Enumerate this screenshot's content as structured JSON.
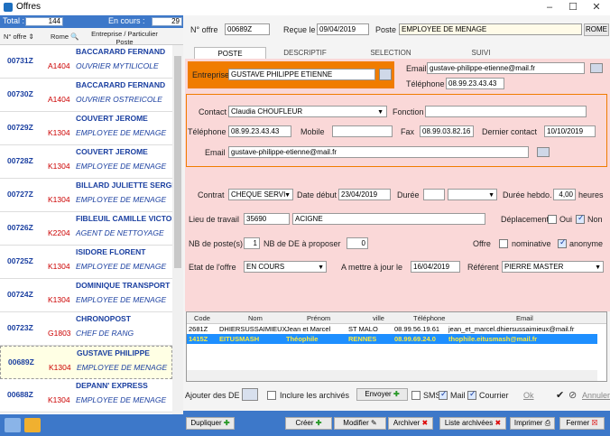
{
  "window": {
    "title": "Offres",
    "min": "–",
    "max": "☐",
    "close": "✕"
  },
  "left": {
    "total_label": "Total :",
    "total_value": "144",
    "en_cours_label": "En cours :",
    "en_cours_value": "29",
    "col_offre": "N° offre",
    "col_rome": "Rome",
    "col_entreprise": "Entreprise / Particulier",
    "col_poste": "Poste",
    "rows": [
      {
        "num": "00731Z",
        "rome": "A1404",
        "company": "BACCARARD FERNAND",
        "job": "OUVRIER MYTILICOLE"
      },
      {
        "num": "00730Z",
        "rome": "A1404",
        "company": "BACCARARD FERNAND",
        "job": "OUVRIER OSTREICOLE"
      },
      {
        "num": "00729Z",
        "rome": "K1304",
        "company": "COUVERT JEROME",
        "job": "EMPLOYEE DE MENAGE"
      },
      {
        "num": "00728Z",
        "rome": "K1304",
        "company": "COUVERT JEROME",
        "job": "EMPLOYEE DE MENAGE"
      },
      {
        "num": "00727Z",
        "rome": "K1304",
        "company": "BILLARD JULIETTE SERGE",
        "job": "EMPLOYEE DE MENAGE"
      },
      {
        "num": "00726Z",
        "rome": "K2204",
        "company": "FIBLEUIL CAMILLE VICTOR",
        "job": "AGENT DE NETTOYAGE"
      },
      {
        "num": "00725Z",
        "rome": "K1304",
        "company": "ISIDORE FLORENT",
        "job": "EMPLOYEE DE MENAGE"
      },
      {
        "num": "00724Z",
        "rome": "K1304",
        "company": "DOMINIQUE TRANSPORT",
        "job": "EMPLOYEE DE MENAGE"
      },
      {
        "num": "00723Z",
        "rome": "G1803",
        "company": "CHRONOPOST",
        "job": "CHEF DE RANG"
      },
      {
        "num": "00689Z",
        "rome": "K1304",
        "company": "GUSTAVE PHILIPPE",
        "job": "EMPLOYEE DE MENAGE"
      },
      {
        "num": "00688Z",
        "rome": "K1304",
        "company": "DEPANN' EXPRESS",
        "job": "EMPLOYEE DE MENAGE"
      }
    ]
  },
  "header": {
    "offre_label": "N° offre",
    "offre_value": "00689Z",
    "recue_label": "Reçue le",
    "recue_value": "09/04/2019",
    "poste_label": "Poste",
    "poste_value": "EMPLOYEE DE MENAGE",
    "rome_button": "ROME"
  },
  "tabs": [
    "POSTE",
    "DESCRIPTIF",
    "SELECTION",
    "SUIVI"
  ],
  "entreprise": {
    "label": "Entreprise",
    "value": "GUSTAVE PHILIPPE ETIENNE",
    "email_label": "Email",
    "email_value": "gustave-philippe-etienne@mail.fr",
    "tel_label": "Téléphone",
    "tel_value": "08.99.23.43.43"
  },
  "contact": {
    "label": "Contact",
    "value": "Claudia CHOUFLEUR",
    "fonction_label": "Fonction",
    "fonction_value": "",
    "tel_label": "Téléphone",
    "tel_value": "08.99.23.43.43",
    "mobile_label": "Mobile",
    "mobile_value": "",
    "fax_label": "Fax",
    "fax_value": "08.99.03.82.16",
    "dernier_label": "Dernier contact",
    "dernier_value": "10/10/2019",
    "email_label": "Email",
    "email_value": "gustave-philippe-etienne@mail.fr"
  },
  "contrat": {
    "label": "Contrat",
    "value": "CHEQUE SERVI",
    "date_label": "Date début",
    "date_value": "23/04/2019",
    "duree_label": "Durée",
    "duree_value": "",
    "duree_unit": "",
    "hebdo_label": "Durée hebdo.",
    "hebdo_value": "4,00",
    "heures": "heures",
    "lieu_label": "Lieu de travail",
    "lieu_cp": "35690",
    "lieu_ville": "ACIGNE",
    "deplacement_label": "Déplacement",
    "oui": "Oui",
    "non": "Non",
    "nb_poste_label": "NB de poste(s)",
    "nb_poste_value": "1",
    "nb_proposer_label": "NB de DE à proposer",
    "nb_proposer_value": "0",
    "offre_label": "Offre",
    "nominative": "nominative",
    "anonyme": "anonyme",
    "etat_label": "Etat de l'offre",
    "etat_value": "EN COURS",
    "maj_label": "A mettre à jour le",
    "maj_value": "16/04/2019",
    "referent_label": "Référent",
    "referent_value": "PIERRE  MASTER"
  },
  "grid": {
    "headers": [
      "Code",
      "Nom",
      "Prénom",
      "ville",
      "Téléphone",
      "Email"
    ],
    "rows": [
      [
        "2681Z",
        "DHIERSUSSAIMIEUX",
        "Jean et Marcel",
        "ST MALO",
        "08.99.56.19.61",
        "jean_et_marcel.dhiersussaimieux@mail.fr"
      ],
      [
        "1415Z",
        "EITUSMASH",
        "Théophile",
        "RENNES",
        "08.99.69.24.0",
        "thophile.eitusmash@mail.fr"
      ]
    ]
  },
  "bottom": {
    "ajouter": "Ajouter des DE",
    "inclure": "Inclure les archivés",
    "envoyer": "Envoyer",
    "sms": "SMS",
    "mail": "Mail",
    "courrier": "Courrier",
    "ok": "Ok",
    "annuler": "Annuler"
  },
  "footer": {
    "dupliquer": "Dupliquer",
    "creer": "Créer",
    "modifier": "Modifier",
    "archiver": "Archiver",
    "liste": "Liste archivées",
    "imprimer": "Imprimer",
    "fermer": "Fermer"
  },
  "colors": {
    "accent": "#3d78c9",
    "orange": "#f07c00",
    "pink": "#fad8d8",
    "link": "#1a3fa0",
    "highlight": "#1e8fff"
  }
}
